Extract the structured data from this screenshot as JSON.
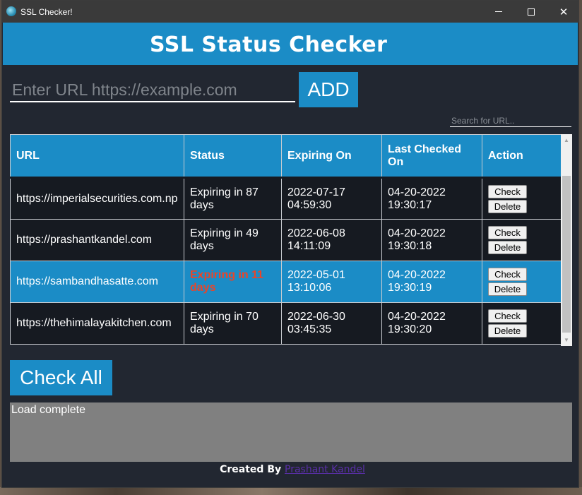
{
  "window": {
    "title": "SSL Checker!"
  },
  "header": {
    "title": "SSL Status Checker"
  },
  "add": {
    "placeholder": "Enter URL https://example.com",
    "button_label": "ADD"
  },
  "search": {
    "placeholder": "Search for URL.."
  },
  "table": {
    "columns": [
      "URL",
      "Status",
      "Expiring On",
      "Last Checked On",
      "Action"
    ],
    "rows": [
      {
        "url": "https://imperialsecurities.com.np",
        "status": "Expiring in 87 days",
        "expiring_on": "2022-07-17 04:59:30",
        "last_checked": "04-20-2022 19:30:17",
        "check_label": "Check",
        "delete_label": "Delete"
      },
      {
        "url": "https://prashantkandel.com",
        "status": "Expiring in 49 days",
        "expiring_on": "2022-06-08 14:11:09",
        "last_checked": "04-20-2022 19:30:18",
        "check_label": "Check",
        "delete_label": "Delete"
      },
      {
        "url": "https://sambandhasatte.com",
        "status": "Expiring in 11 days",
        "expiring_on": "2022-05-01 13:10:06",
        "last_checked": "04-20-2022 19:30:19",
        "check_label": "Check",
        "delete_label": "Delete"
      },
      {
        "url": "https://thehimalayakitchen.com",
        "status": "Expiring in 70 days",
        "expiring_on": "2022-06-30 03:45:35",
        "last_checked": "04-20-2022 19:30:20",
        "check_label": "Check",
        "delete_label": "Delete"
      }
    ],
    "selected_row": 2
  },
  "check_all": {
    "label": "Check All"
  },
  "log": {
    "text": "Load complete"
  },
  "footer": {
    "prefix": "Created By",
    "author": "Prashant Kandel"
  },
  "colors": {
    "accent": "#1b8cc6",
    "background": "#222731",
    "warning": "#e8452a",
    "log_bg": "#808080"
  }
}
